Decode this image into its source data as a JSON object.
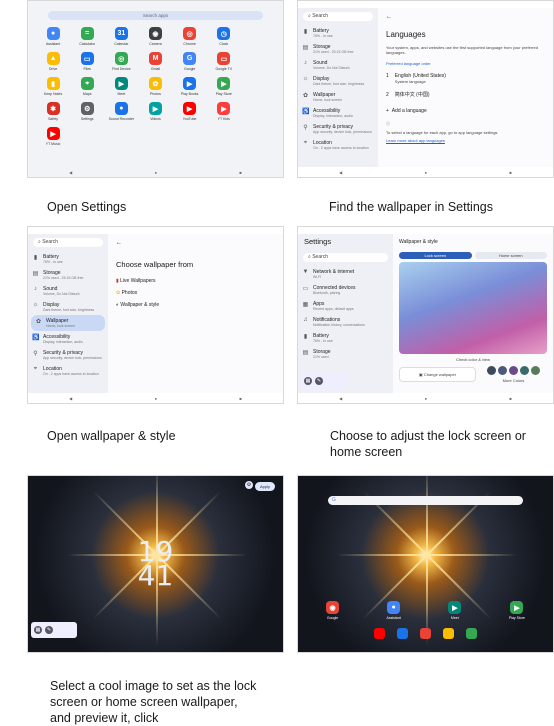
{
  "captions": {
    "c1": "Open Settings",
    "c2": "Find the wallpaper in Settings",
    "c3": "Open wallpaper & style",
    "c4": "Choose to adjust the lock screen or home screen",
    "c5": "Select a cool image to set as the lock screen or home screen wallpaper, and preview it, click"
  },
  "shot1": {
    "search_placeholder": "Search apps",
    "apps": [
      {
        "label": "Assistant",
        "color": "#4285f4",
        "glyph": "●"
      },
      {
        "label": "Calculator",
        "color": "#34a853",
        "glyph": "="
      },
      {
        "label": "Calendar",
        "color": "#1a73e8",
        "glyph": "31"
      },
      {
        "label": "Camera",
        "color": "#3c4043",
        "glyph": "◉"
      },
      {
        "label": "Chrome",
        "color": "#ea4335",
        "glyph": "◎"
      },
      {
        "label": "Clock",
        "color": "#1a73e8",
        "glyph": "◷"
      },
      {
        "label": "",
        "color": "transparent",
        "glyph": ""
      },
      {
        "label": "Drive",
        "color": "#fbbc04",
        "glyph": "▲"
      },
      {
        "label": "Files",
        "color": "#1a73e8",
        "glyph": "▭"
      },
      {
        "label": "Find Device",
        "color": "#34a853",
        "glyph": "◎"
      },
      {
        "label": "Gmail",
        "color": "#ea4335",
        "glyph": "M"
      },
      {
        "label": "Google",
        "color": "#4285f4",
        "glyph": "G"
      },
      {
        "label": "Google TV",
        "color": "#ea4335",
        "glyph": "▭"
      },
      {
        "label": "",
        "color": "transparent",
        "glyph": ""
      },
      {
        "label": "Keep Notes",
        "color": "#fbbc04",
        "glyph": "▮"
      },
      {
        "label": "Maps",
        "color": "#34a853",
        "glyph": "⌖"
      },
      {
        "label": "Meet",
        "color": "#00897b",
        "glyph": "▶"
      },
      {
        "label": "Photos",
        "color": "#fbbc04",
        "glyph": "✿"
      },
      {
        "label": "Play Books",
        "color": "#1a73e8",
        "glyph": "▶"
      },
      {
        "label": "Play Store",
        "color": "#34a853",
        "glyph": "▶"
      },
      {
        "label": "",
        "color": "transparent",
        "glyph": ""
      },
      {
        "label": "Safety",
        "color": "#d93025",
        "glyph": "✱"
      },
      {
        "label": "Settings",
        "color": "#5f6368",
        "glyph": "⚙"
      },
      {
        "label": "Sound Recorder",
        "color": "#1a73e8",
        "glyph": "●"
      },
      {
        "label": "Videos",
        "color": "#00a3a3",
        "glyph": "▶"
      },
      {
        "label": "YouTube",
        "color": "#ff0000",
        "glyph": "▶"
      },
      {
        "label": "YT Kids",
        "color": "#ff3d3d",
        "glyph": "▶"
      },
      {
        "label": "",
        "color": "transparent",
        "glyph": ""
      },
      {
        "label": "YT Music",
        "color": "#ff0000",
        "glyph": "▶"
      }
    ]
  },
  "shot2": {
    "search": "Search",
    "sidebar": [
      {
        "title": "Battery",
        "sub": "76% - In use"
      },
      {
        "title": "Storage",
        "sub": "21% used - 25.15 GB free"
      },
      {
        "title": "Sound",
        "sub": "Volume, Do Not Disturb"
      },
      {
        "title": "Display",
        "sub": "Dark theme, font size, brightness"
      },
      {
        "title": "Wallpaper",
        "sub": "Home, lock screen"
      },
      {
        "title": "Accessibility",
        "sub": "Display, interaction, audio"
      },
      {
        "title": "Security & privacy",
        "sub": "App security, device lock, permissions"
      },
      {
        "title": "Location",
        "sub": "On - 2 apps have access to location"
      }
    ],
    "heading": "Languages",
    "desc": "Your system, apps, and websites use the first supported language from your preferred languages.",
    "pref_label": "Preferred language order",
    "lang1": "English (United States)",
    "lang1_sub": "System language",
    "lang2": "简体中文 (中国)",
    "add": "Add a language",
    "foot": "To select a language for each app, go to app language settings",
    "link": "Learn more about app languages"
  },
  "shot3": {
    "heading": "Choose wallpaper from",
    "options": [
      "Live Wallpapers",
      "Photos",
      "Wallpaper & style"
    ]
  },
  "shot4": {
    "title": "Settings",
    "search": "Search",
    "items": [
      {
        "title": "Network & internet",
        "sub": "Wi-Fi"
      },
      {
        "title": "Connected devices",
        "sub": "Bluetooth, pairing"
      },
      {
        "title": "Apps",
        "sub": "Recent apps, default apps"
      },
      {
        "title": "Notifications",
        "sub": "Notification history, conversations"
      },
      {
        "title": "Battery",
        "sub": "76% - In use"
      },
      {
        "title": "Storage",
        "sub": "21% used"
      }
    ],
    "panel_title": "Wallpaper & style",
    "tab_lock": "Lock screen",
    "tab_home": "Home screen",
    "check": "Check color & view",
    "change": "Change wallpaper",
    "more": "More Colors",
    "swatches": [
      "#3d4a5c",
      "#4b5a7a",
      "#6b4a8a",
      "#3a6b6b",
      "#5a7a5a"
    ]
  },
  "shot5": {
    "apply": "Apply",
    "hour": "19",
    "minute": "41"
  },
  "shot6": {
    "search_g": "G",
    "apps": [
      {
        "label": "Google",
        "color": "#ea4335",
        "glyph": "◉"
      },
      {
        "label": "Assistant",
        "color": "#4285f4",
        "glyph": "●"
      },
      {
        "label": "Meet",
        "color": "#00897b",
        "glyph": "▶"
      },
      {
        "label": "Play Store",
        "color": "#34a853",
        "glyph": "▶"
      }
    ],
    "dock": [
      "#ff0000",
      "#1a73e8",
      "#ea4335",
      "#fbbc04",
      "#34a853"
    ]
  }
}
